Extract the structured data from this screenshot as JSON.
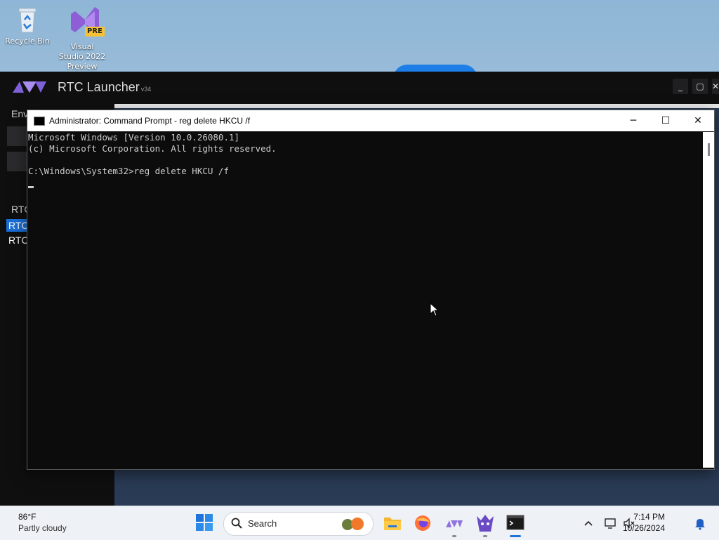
{
  "desktop": {
    "icons": [
      {
        "label": "Recycle Bin"
      },
      {
        "label": "Visual Studio 2022 Preview",
        "badge": "PRE"
      }
    ]
  },
  "rtc_launcher": {
    "title": "RTC Launcher",
    "version": "v34",
    "side_label": "Env",
    "list_header": "RTC",
    "list_items": [
      "RTC",
      "RTC"
    ],
    "accent": "#7e60d8",
    "selected_color": "#1a6fd6"
  },
  "cmd": {
    "title": "Administrator: Command Prompt - reg  delete HKCU /f",
    "lines": [
      "Microsoft Windows [Version 10.0.26080.1]",
      "(c) Microsoft Corporation. All rights reserved.",
      "",
      "C:\\Windows\\System32>reg delete HKCU /f"
    ]
  },
  "taskbar": {
    "weather_temp": "86°F",
    "weather_desc": "Partly cloudy",
    "search_label": "Search",
    "time": "7:14 PM",
    "date": "10/26/2024",
    "pinned": [
      "start-icon",
      "file-explorer-icon",
      "firefox-icon",
      "rtc-launcher-icon",
      "game-app-icon",
      "terminal-icon"
    ]
  }
}
